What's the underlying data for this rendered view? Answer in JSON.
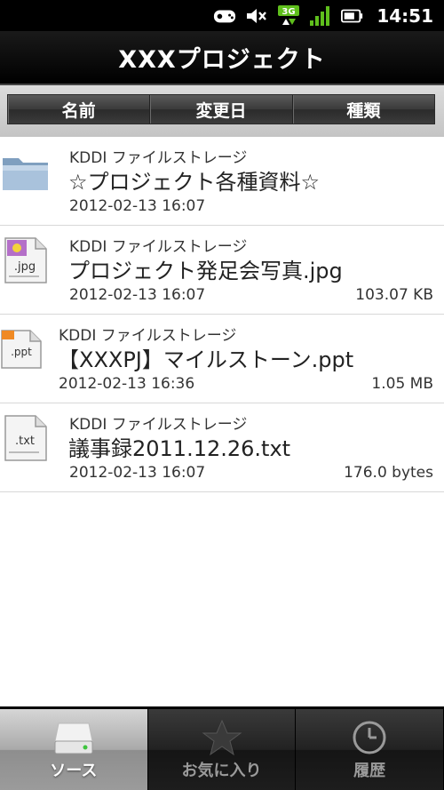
{
  "status": {
    "time": "14:51",
    "network": "3G",
    "icons": [
      "gamepad-icon",
      "mute-icon",
      "3g-data-icon",
      "signal-icon",
      "battery-icon"
    ]
  },
  "title": "XXXプロジェクト",
  "sort": {
    "name": "名前",
    "modified": "変更日",
    "type": "種類"
  },
  "files": [
    {
      "source": "KDDI ファイルストレージ",
      "name": "☆プロジェクト各種資料☆",
      "date": "2012-02-13 16:07",
      "size": "",
      "icon": "folder-icon"
    },
    {
      "source": "KDDI ファイルストレージ",
      "name": "プロジェクト発足会写真.jpg",
      "date": "2012-02-13 16:07",
      "size": "103.07 KB",
      "icon": "jpg-file-icon",
      "ext": ".jpg"
    },
    {
      "source": "KDDI ファイルストレージ",
      "name": "【XXXPJ】マイルストーン.ppt",
      "date": "2012-02-13 16:36",
      "size": "1.05 MB",
      "icon": "ppt-file-icon",
      "ext": ".ppt"
    },
    {
      "source": "KDDI ファイルストレージ",
      "name": "議事録2011.12.26.txt",
      "date": "2012-02-13 16:07",
      "size": "176.0 bytes",
      "icon": "txt-file-icon",
      "ext": ".txt"
    }
  ],
  "tabs": {
    "source": "ソース",
    "favorites": "お気に入り",
    "history": "履歴"
  },
  "colors": {
    "active_tab": "#a9a9a9",
    "bar": "#000000",
    "ppt_accent": "#f08a24",
    "folder": "#9fb8d2"
  }
}
